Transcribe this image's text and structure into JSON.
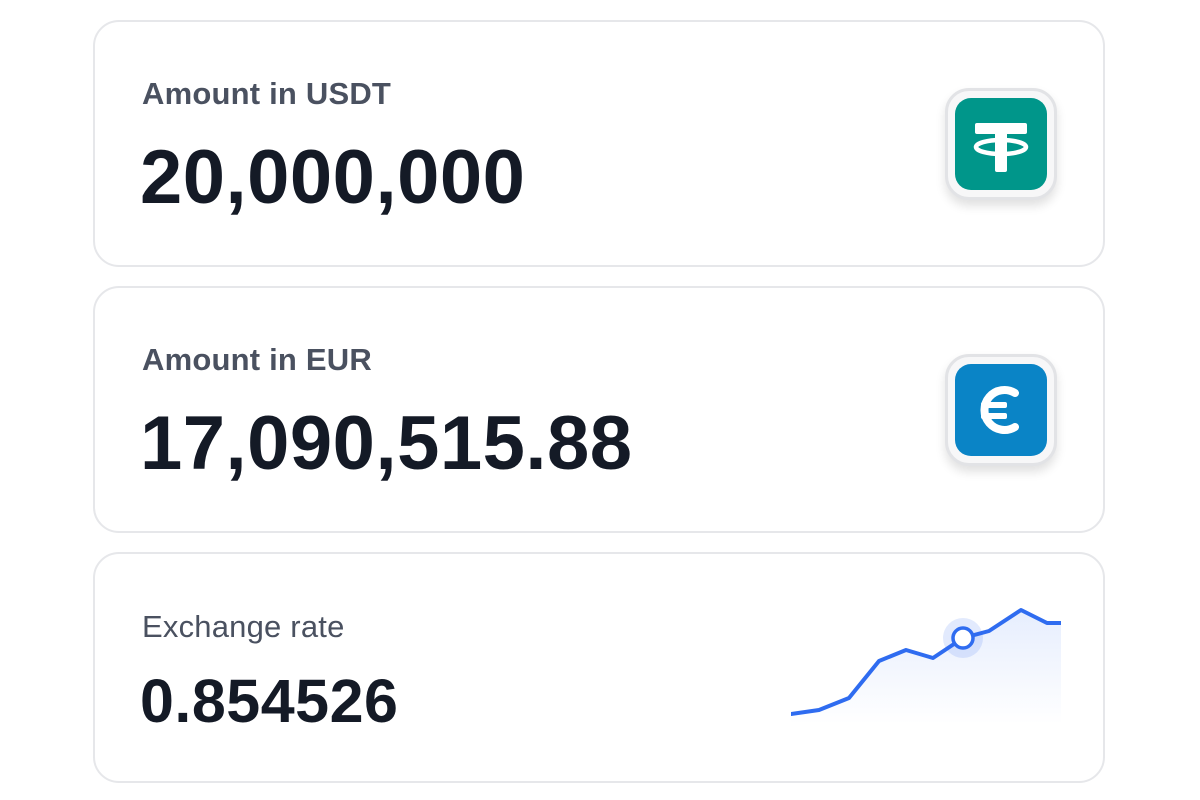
{
  "cards": {
    "usdt": {
      "label": "Amount in USDT",
      "value": "20,000,000",
      "icon": "tether-icon",
      "icon_color": "#00968a"
    },
    "eur": {
      "label": "Amount in EUR",
      "value": "17,090,515.88",
      "icon": "euro-icon",
      "icon_color": "#0a84c6"
    },
    "rate": {
      "label": "Exchange rate",
      "value": "0.854526",
      "sparkline_color": "#2f6cf0"
    }
  }
}
